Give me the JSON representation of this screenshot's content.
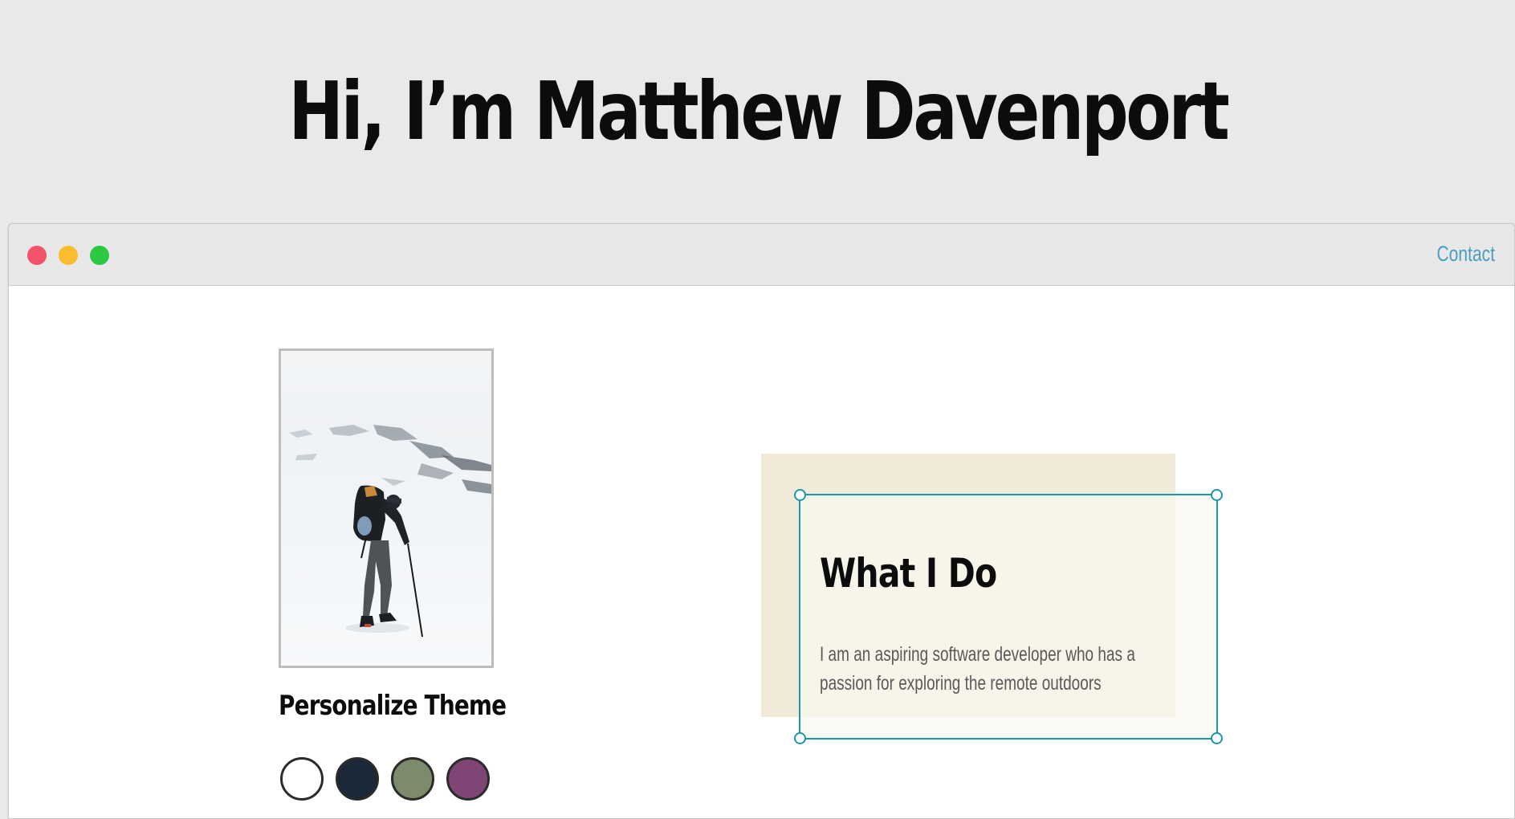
{
  "header": {
    "title": "Hi, I’m Matthew Davenport"
  },
  "window": {
    "controls": {
      "close_color": "#f2536a",
      "minimize_color": "#fbbc2e",
      "maximize_color": "#2bc840"
    },
    "nav": {
      "contact_label": "Contact",
      "link_color": "#4a9fc2"
    }
  },
  "profile": {
    "photo_icon": "hiker-in-snow-photo"
  },
  "theme": {
    "heading": "Personalize Theme",
    "swatches": [
      {
        "name": "light",
        "color": "#ffffff"
      },
      {
        "name": "dark-blue",
        "color": "#1b2838"
      },
      {
        "name": "green",
        "color": "#7c8b6c"
      },
      {
        "name": "purple",
        "color": "#7e4575"
      }
    ]
  },
  "about": {
    "title": "What I Do",
    "body": "I am an aspiring software developer who has a passion for exploring the remote outdoors",
    "backdrop_color": "#f1ead8",
    "accent_color": "#1e97ab"
  }
}
